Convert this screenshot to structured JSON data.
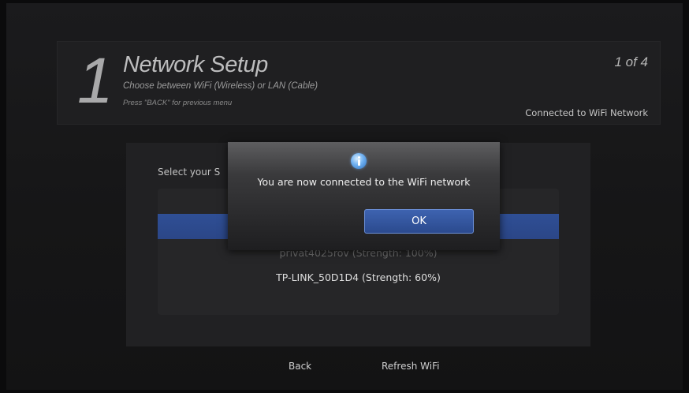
{
  "header": {
    "step_number": "1",
    "title": "Network Setup",
    "subtitle": "Choose between WiFi (Wireless) or LAN (Cable)",
    "hint": "Press \"BACK\" for previous menu",
    "pager": "1 of 4",
    "connection_status": "Connected to WiFi Network"
  },
  "panel": {
    "select_label": "Select your S",
    "networks": [
      "privat4025rov (Strength: 100%)",
      "TP-LINK_50D1D4 (Strength: 60%)"
    ]
  },
  "dialog": {
    "icon": "info-icon",
    "message": "You are now connected to the WiFi network",
    "ok_label": "OK"
  },
  "footer": {
    "back_label": "Back",
    "refresh_label": "Refresh WiFi"
  },
  "colors": {
    "background": "#161617",
    "highlight": "#2f4f95",
    "ok_button": "#3a5ca6"
  }
}
